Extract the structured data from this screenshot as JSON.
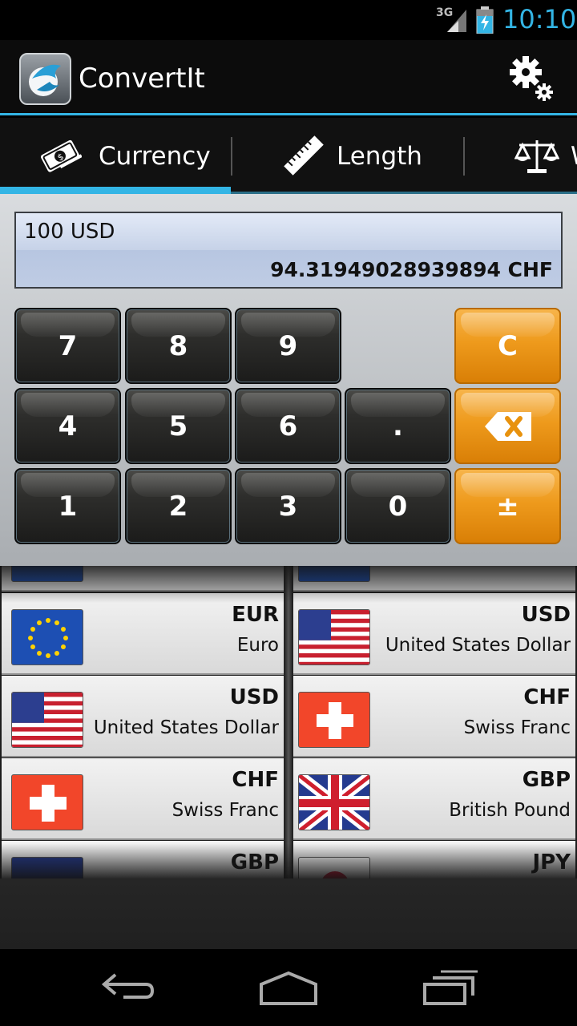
{
  "status": {
    "network": "3G",
    "time": "10:10"
  },
  "app": {
    "title": "ConvertIt"
  },
  "tabs": [
    {
      "label": "Currency",
      "icon": "currency-icon",
      "active": true
    },
    {
      "label": "Length",
      "icon": "ruler-icon",
      "active": false
    },
    {
      "label": "W",
      "icon": "scale-icon",
      "active": false
    }
  ],
  "display": {
    "input": "100 USD",
    "result": "94.31949028939894 CHF"
  },
  "keypad": {
    "k7": "7",
    "k8": "8",
    "k9": "9",
    "clear": "C",
    "k4": "4",
    "k5": "5",
    "k6": "6",
    "dot": ".",
    "k1": "1",
    "k2": "2",
    "k3": "3",
    "k0": "0",
    "plusminus": "±"
  },
  "from_list": [
    {
      "code": "EUR",
      "name": "Euro",
      "flag": "eu-flag"
    },
    {
      "code": "USD",
      "name": "United States Dollar",
      "flag": "us-flag"
    },
    {
      "code": "CHF",
      "name": "Swiss Franc",
      "flag": "ch-flag"
    },
    {
      "code": "GBP",
      "name": "",
      "flag": "gb-flag"
    }
  ],
  "to_list": [
    {
      "code": "USD",
      "name": "United States Dollar",
      "flag": "us-flag"
    },
    {
      "code": "CHF",
      "name": "Swiss Franc",
      "flag": "ch-flag"
    },
    {
      "code": "GBP",
      "name": "British Pound",
      "flag": "gb-flag"
    },
    {
      "code": "JPY",
      "name": "",
      "flag": "jp-flag"
    }
  ],
  "colors": {
    "accent": "#33b5e5",
    "orange_key": "#ee9a1c"
  }
}
